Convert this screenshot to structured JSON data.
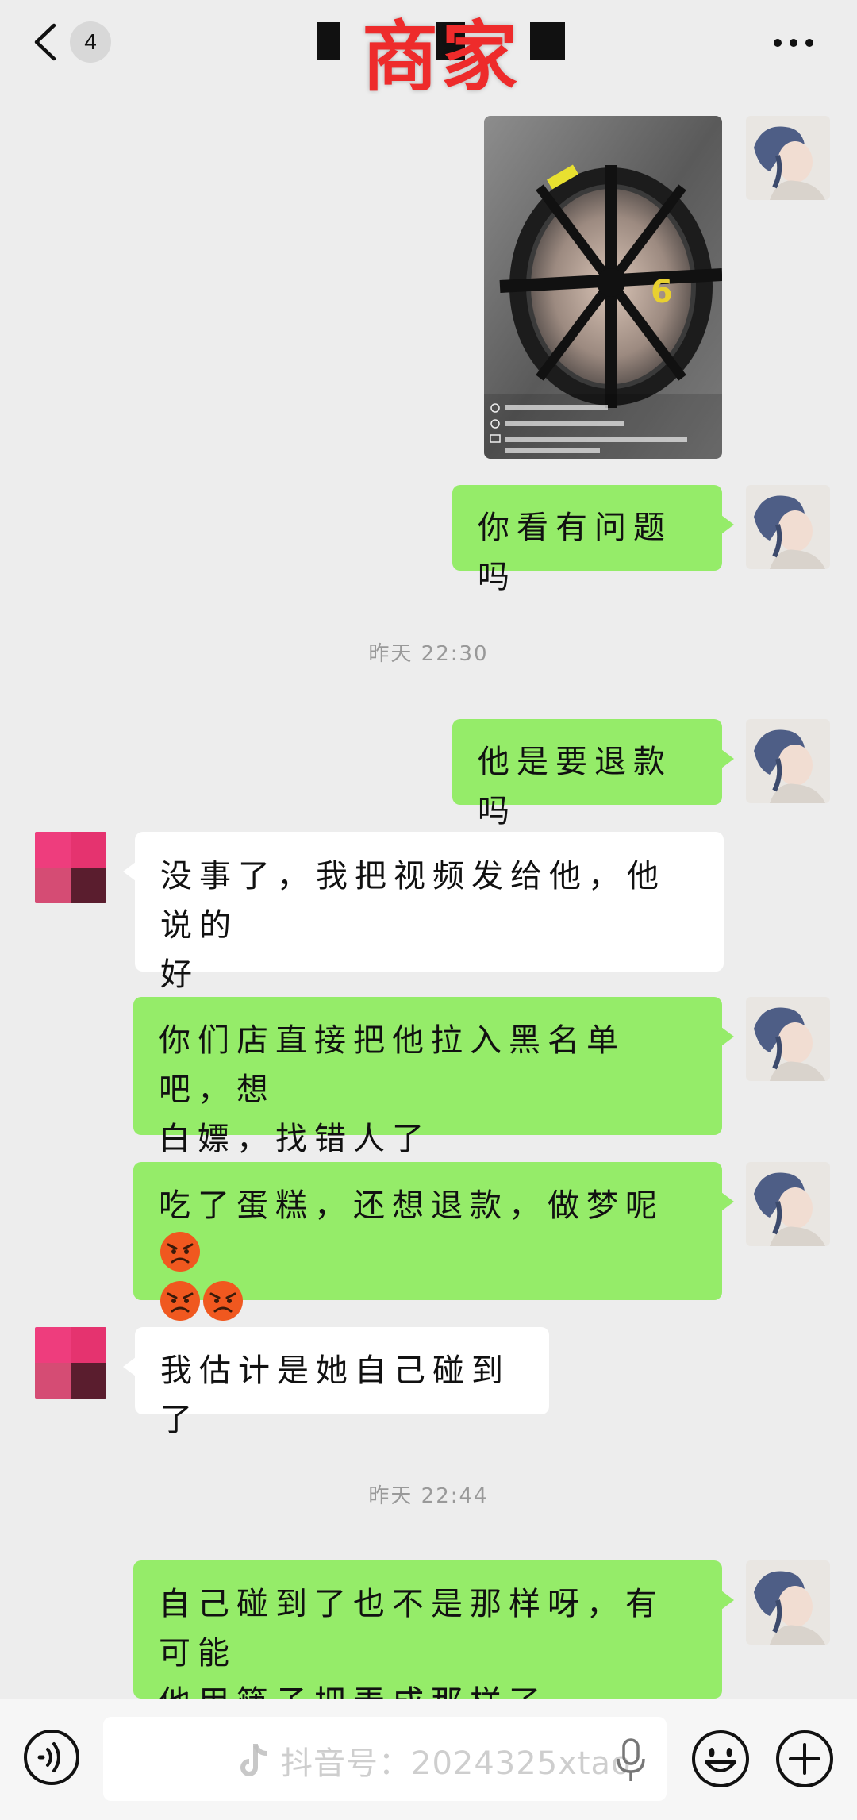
{
  "header": {
    "unread_count": "4",
    "title": "商家"
  },
  "messages": [
    {
      "type": "image",
      "from": "self"
    },
    {
      "type": "text",
      "from": "self",
      "text": "你看有问题吗"
    },
    {
      "type": "time",
      "text": "昨天 22:30"
    },
    {
      "type": "text",
      "from": "self",
      "text": "他是要退款吗"
    },
    {
      "type": "text",
      "from": "other",
      "lines": [
        "没事了，我把视频发给他，他说的",
        "好"
      ]
    },
    {
      "type": "text",
      "from": "self",
      "lines": [
        "你们店直接把他拉入黑名单吧，想",
        "白嫖，找错人了"
      ]
    },
    {
      "type": "text",
      "from": "self",
      "line1": "吃了蛋糕，还想退款，做梦呢",
      "emojis": [
        "angry-face",
        "angry-face",
        "angry-face"
      ]
    },
    {
      "type": "text",
      "from": "other",
      "text": "我估计是她自己碰到了"
    },
    {
      "type": "time",
      "text": "昨天 22:44"
    },
    {
      "type": "text",
      "from": "self",
      "lines": [
        "自己碰到了也不是那样呀，有可能",
        "他用筷子把弄成那样了"
      ]
    }
  ],
  "input_bar": {
    "watermark": "抖音号：2024325xtao",
    "input_value": ""
  },
  "colors": {
    "background": "#ededed",
    "self_bubble": "#95ec69",
    "other_bubble": "#ffffff",
    "title_red": "#ee2b2b"
  },
  "icons": [
    "back-chevron-icon",
    "more-dots-icon",
    "voice-icon",
    "microphone-icon",
    "emoji-icon",
    "plus-icon",
    "tiktok-logo-icon"
  ]
}
